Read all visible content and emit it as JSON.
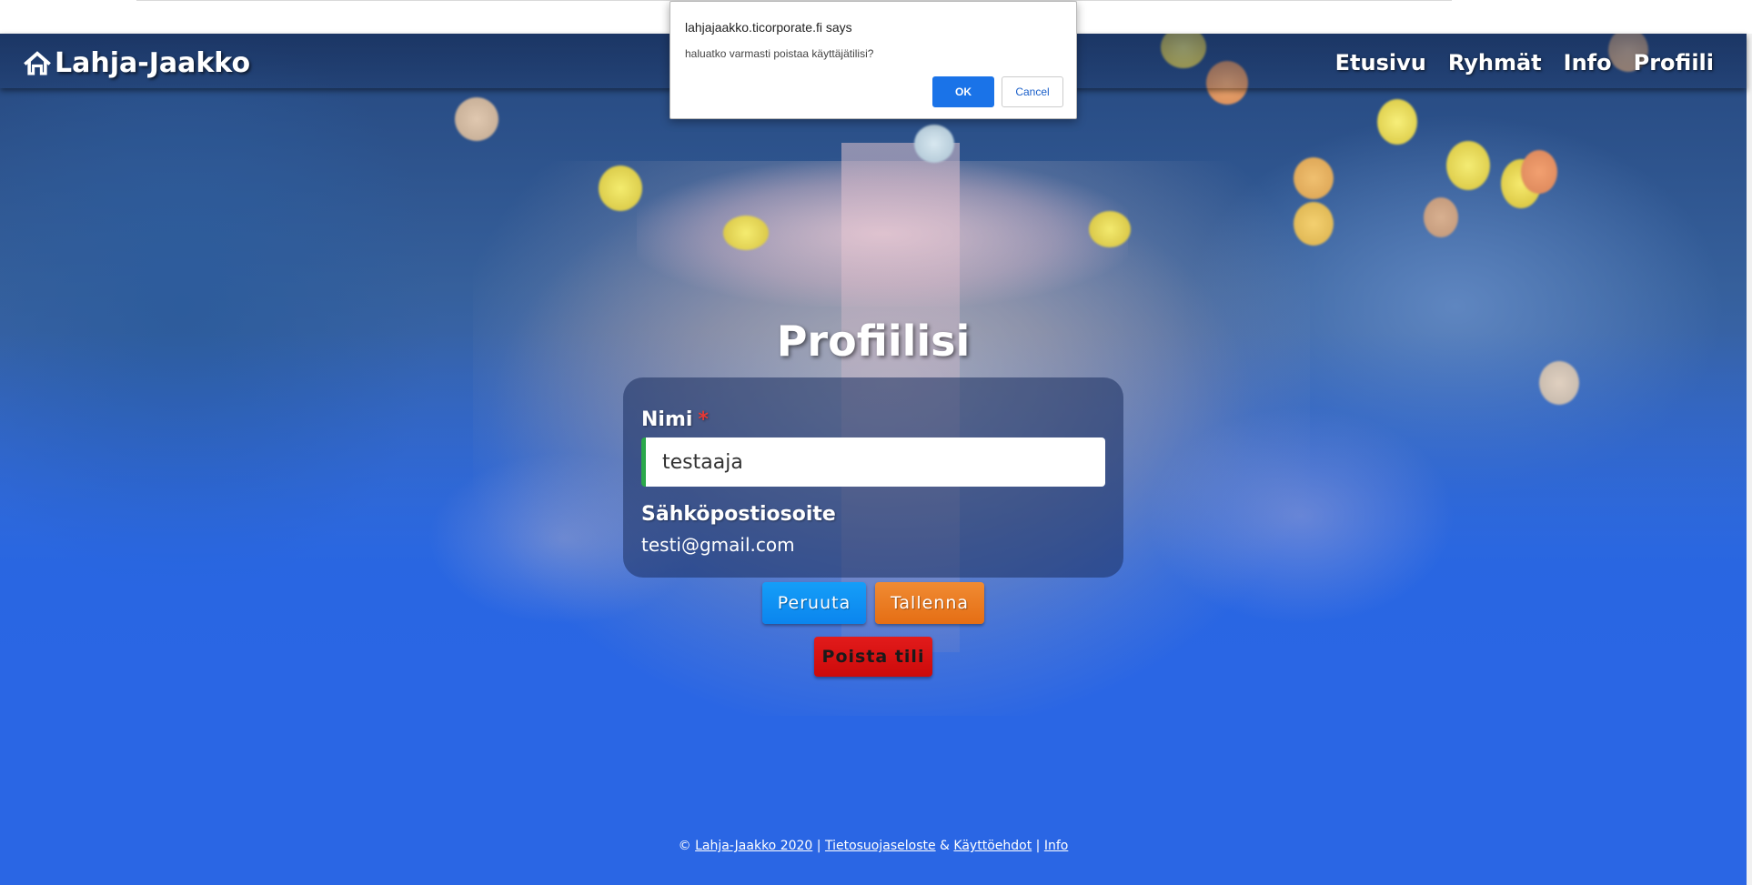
{
  "navbar": {
    "brand": "Lahja-Jaakko",
    "links": [
      "Etusivu",
      "Ryhmät",
      "Info",
      "Profiili"
    ]
  },
  "main": {
    "title": "Profiilisi",
    "name_label": "Nimi",
    "required_mark": "*",
    "name_value": "testaaja",
    "email_label": "Sähköpostiosoite",
    "email_value": "testi@gmail.com",
    "cancel_button": "Peruuta",
    "save_button": "Tallenna",
    "delete_button": "Poista tili"
  },
  "footer": {
    "copyright": "©",
    "brand_link": "Lahja-Jaakko 2020",
    "sep1": "|",
    "privacy_link": "Tietosuojaseloste",
    "amp": "&",
    "terms_link": "Käyttöehdot",
    "sep2": "|",
    "info_link": "Info"
  },
  "dialog": {
    "title": "lahjajaakko.ticorporate.fi says",
    "message": "haluatko varmasti poistaa käyttäjätilisi?",
    "ok_label": "OK",
    "cancel_label": "Cancel"
  },
  "colors": {
    "accent_blue": "#2a66e4",
    "cancel_button": "#0b85ee",
    "save_button": "#e56e14",
    "delete_button": "#cc0a0a",
    "dialog_ok": "#1a73e8"
  },
  "icons": {
    "brand": "home-icon"
  }
}
